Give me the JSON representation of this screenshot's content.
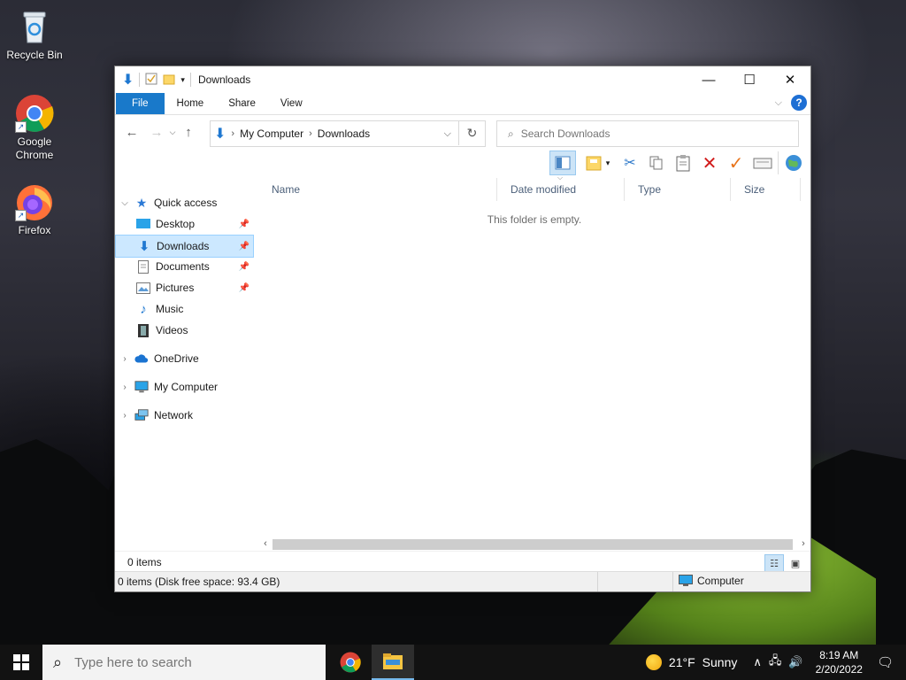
{
  "desktop": {
    "icons": [
      {
        "label": "Recycle Bin"
      },
      {
        "label": "Google Chrome"
      },
      {
        "label": "Firefox"
      }
    ]
  },
  "window": {
    "title": "Downloads",
    "ribbon_tabs": [
      "File",
      "Home",
      "Share",
      "View"
    ],
    "help_label": "?",
    "breadcrumb": [
      "My Computer",
      "Downloads"
    ],
    "search_placeholder": "Search Downloads",
    "nav": {
      "quick_access": "Quick access",
      "items": [
        {
          "label": "Desktop",
          "pinned": true
        },
        {
          "label": "Downloads",
          "pinned": true,
          "selected": true
        },
        {
          "label": "Documents",
          "pinned": true
        },
        {
          "label": "Pictures",
          "pinned": true
        },
        {
          "label": "Music",
          "pinned": false
        },
        {
          "label": "Videos",
          "pinned": false
        }
      ],
      "onedrive": "OneDrive",
      "my_computer": "My Computer",
      "network": "Network"
    },
    "columns": [
      "Name",
      "Date modified",
      "Type",
      "Size"
    ],
    "empty_message": "This folder is empty.",
    "item_count": "0 items",
    "status_detail": "0 items (Disk free space: 93.4 GB)",
    "status_location": "Computer"
  },
  "taskbar": {
    "search_placeholder": "Type here to search",
    "weather_temp": "21°F",
    "weather_desc": "Sunny",
    "time": "8:19 AM",
    "date": "2/20/2022"
  },
  "colors": {
    "accent": "#1979ca",
    "selection": "#cce8ff",
    "delete_red": "#d11c1c",
    "check_orange": "#e8741b"
  }
}
